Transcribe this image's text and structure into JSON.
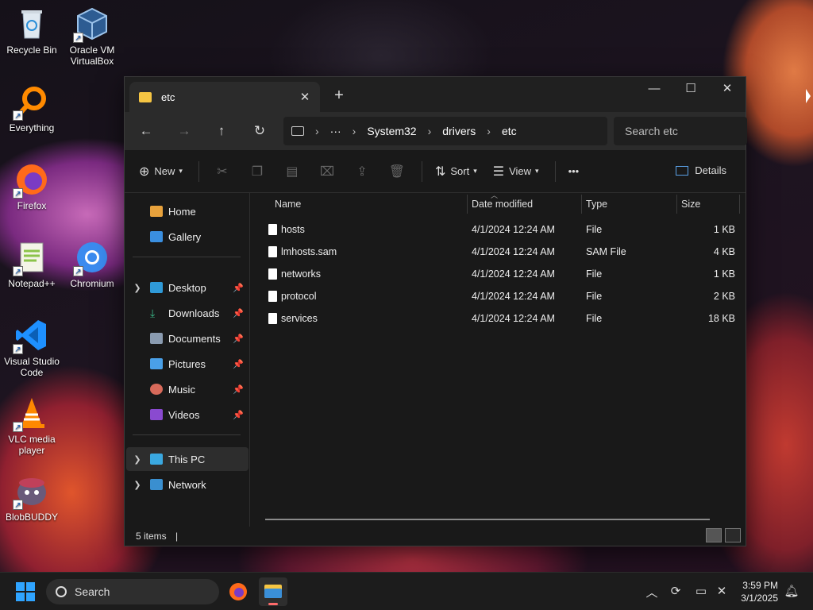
{
  "desktop": {
    "icons": [
      {
        "label": "Recycle Bin",
        "icon": "recycle-bin-icon"
      },
      {
        "label": "Oracle VM VirtualBox",
        "icon": "virtualbox-icon"
      },
      {
        "label": "Everything",
        "icon": "everything-search-icon"
      },
      {
        "label": "Firefox",
        "icon": "firefox-icon"
      },
      {
        "label": "Notepad++",
        "icon": "notepadpp-icon"
      },
      {
        "label": "Chromium",
        "icon": "chromium-icon"
      },
      {
        "label": "Visual Studio Code",
        "icon": "vscode-icon"
      },
      {
        "label": "VLC media player",
        "icon": "vlc-icon"
      },
      {
        "label": "BlobBUDDY",
        "icon": "blobbuddy-icon"
      }
    ]
  },
  "window": {
    "tab_title": "etc",
    "controls": {
      "minimize": "—",
      "maximize": "☐",
      "close": "✕"
    },
    "breadcrumb": [
      "System32",
      "drivers",
      "etc"
    ],
    "breadcrumb_more": "···",
    "search_placeholder": "Search etc",
    "toolbar": {
      "new_label": "New",
      "sort_label": "Sort",
      "view_label": "View",
      "more_label": "•••",
      "details_label": "Details"
    },
    "nav": {
      "home": "Home",
      "gallery": "Gallery",
      "pinned": [
        "Desktop",
        "Downloads",
        "Documents",
        "Pictures",
        "Music",
        "Videos"
      ],
      "this_pc": "This PC",
      "network": "Network"
    },
    "columns": {
      "name": "Name",
      "date": "Date modified",
      "type": "Type",
      "size": "Size"
    },
    "files": [
      {
        "name": "hosts",
        "date": "4/1/2024 12:24 AM",
        "type": "File",
        "size": "1 KB"
      },
      {
        "name": "lmhosts.sam",
        "date": "4/1/2024 12:24 AM",
        "type": "SAM File",
        "size": "4 KB"
      },
      {
        "name": "networks",
        "date": "4/1/2024 12:24 AM",
        "type": "File",
        "size": "1 KB"
      },
      {
        "name": "protocol",
        "date": "4/1/2024 12:24 AM",
        "type": "File",
        "size": "2 KB"
      },
      {
        "name": "services",
        "date": "4/1/2024 12:24 AM",
        "type": "File",
        "size": "18 KB"
      }
    ],
    "status": "5 items"
  },
  "taskbar": {
    "search_label": "Search",
    "time": "3:59 PM",
    "date": "3/1/2025"
  },
  "colors": {
    "accent": "#2fa4ff",
    "folder": "#f5c543"
  }
}
